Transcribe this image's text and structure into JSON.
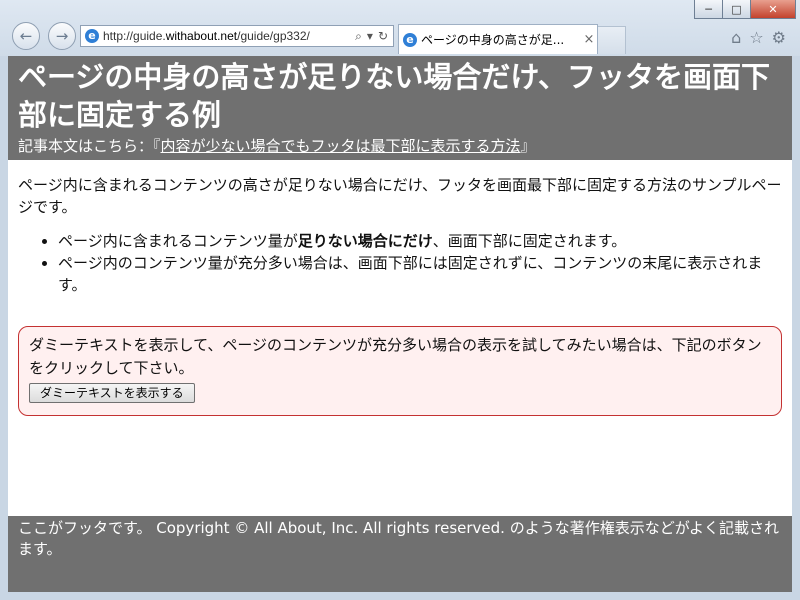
{
  "browser": {
    "url_prefix": "http://guide.",
    "url_domain": "withabout.net",
    "url_path": "/guide/gp332/",
    "tab_title": "ページの中身の高さが足...",
    "tab_close": "×",
    "minimize": "─",
    "maximize": "□",
    "close": "✕",
    "back_icon": "←",
    "forward_icon": "→",
    "search_icon": "⌕",
    "dropdown_icon": "▾",
    "refresh_icon": "↻",
    "home_icon": "⌂",
    "favorites_icon": "☆",
    "settings_icon": "⚙",
    "ie_icon": "e"
  },
  "header": {
    "title": "ページの中身の高さが足りない場合だけ、フッタを画面下部に固定する例",
    "article_prefix": "記事本文はこちら：『",
    "article_link": "内容が少ない場合でもフッタは最下部に表示する方法",
    "article_suffix": "』"
  },
  "content": {
    "intro": "ページ内に含まれるコンテンツの高さが足りない場合にだけ、フッタを画面最下部に固定する方法のサンプルページです。",
    "bullets": [
      {
        "before": "ページ内に含まれるコンテンツ量が",
        "bold": "足りない場合にだけ",
        "after": "、画面下部に固定されます。"
      },
      {
        "text": "ページ内のコンテンツ量が充分多い場合は、画面下部には固定されずに、コンテンツの末尾に表示されます。"
      }
    ]
  },
  "notice": {
    "text": "ダミーテキストを表示して、ページのコンテンツが充分多い場合の表示を試してみたい場合は、下記のボタンをクリックして下さい。",
    "button_label": "ダミーテキストを表示する"
  },
  "footer": {
    "text": "ここがフッタです。 Copyright © All About, Inc. All rights reserved. のような著作権表示などがよく記載されます。"
  },
  "colors": {
    "header_bg": "#707070",
    "notice_border": "#c43131",
    "notice_bg": "#fff0f0"
  }
}
